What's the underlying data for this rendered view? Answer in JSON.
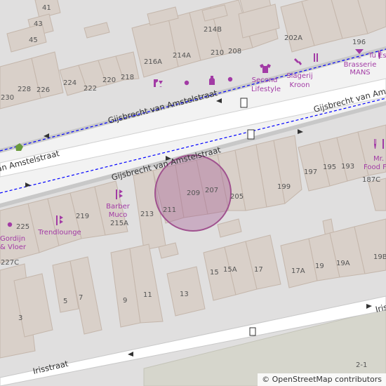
{
  "map": {
    "colors": {
      "background": "#e0dfdf",
      "building": "#d9d0c9",
      "building_stroke": "#c4b6ab",
      "road": "#ffffff",
      "road_casing": "#c8c8c8",
      "cycleway": "#0000ff",
      "poi": "#a23ba5",
      "marker_fill": "#a0528f",
      "park": "#c8e6c1"
    },
    "roads": [
      {
        "name": "Gijsbrecht van Amstelstraat",
        "id": "gva-main-right"
      },
      {
        "name": "Gijsbrecht van Amstelstraat",
        "id": "gva-main-left"
      },
      {
        "name": "Gijsbrecht van Amstelstraat",
        "id": "gva-north-service"
      },
      {
        "name": "Gijsbrecht van Amstelstraat",
        "id": "gva-south-service"
      },
      {
        "name": "Irisstraat",
        "id": "iris-left"
      },
      {
        "name": "Iris",
        "id": "iris-right"
      }
    ],
    "house_numbers": [
      "41",
      "43",
      "45",
      "228",
      "226",
      "230",
      "224",
      "222",
      "220",
      "218",
      "216A",
      "214A",
      "214B",
      "210",
      "208",
      "202A",
      "196",
      "197",
      "195",
      "193",
      "187C",
      "199",
      "205",
      "207",
      "209",
      "211",
      "213",
      "219",
      "215A",
      "225",
      "227C",
      "15",
      "15A",
      "17",
      "17A",
      "19",
      "19A",
      "19B",
      "13",
      "9",
      "11",
      "5",
      "7",
      "3",
      "2-1"
    ],
    "pois": [
      {
        "name": "Second Lifestyle",
        "icon": "clothes-icon"
      },
      {
        "name": "Slagerij Kroon",
        "icon": "butcher-icon"
      },
      {
        "name": "Brasserie MANS",
        "icon": "cocktail-icon"
      },
      {
        "name": "Tu Es",
        "icon": "restaurant-icon"
      },
      {
        "name": "Mr. F Food F",
        "icon": "restaurant-icon"
      },
      {
        "name": "Barber Muco",
        "icon": "hairdresser-icon"
      },
      {
        "name": "Trendlounge",
        "icon": "hairdresser-icon"
      },
      {
        "name": "Gordijn & Vloer",
        "icon": "shop-icon"
      }
    ],
    "attribution": {
      "symbol": "©",
      "text": "OpenStreetMap contributors"
    }
  }
}
